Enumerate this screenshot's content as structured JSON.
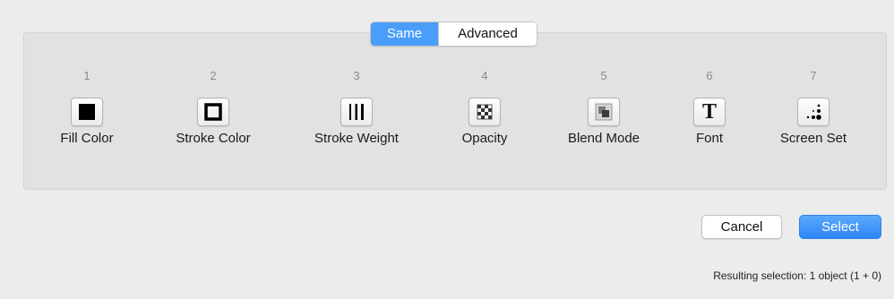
{
  "tabs": {
    "same_label": "Same",
    "advanced_label": "Advanced",
    "active": "Same"
  },
  "options": [
    {
      "number": "1",
      "label": "Fill Color",
      "icon": "fill-color-icon"
    },
    {
      "number": "2",
      "label": "Stroke Color",
      "icon": "stroke-color-icon"
    },
    {
      "number": "3",
      "label": "Stroke Weight",
      "icon": "stroke-weight-icon"
    },
    {
      "number": "4",
      "label": "Opacity",
      "icon": "opacity-icon"
    },
    {
      "number": "5",
      "label": "Blend Mode",
      "icon": "blend-mode-icon"
    },
    {
      "number": "6",
      "label": "Font",
      "icon": "font-icon",
      "glyph": "T"
    },
    {
      "number": "7",
      "label": "Screen Set",
      "icon": "screen-set-icon"
    }
  ],
  "buttons": {
    "cancel_label": "Cancel",
    "select_label": "Select"
  },
  "status": {
    "text": "Resulting selection: 1 object (1 + 0)"
  },
  "colors": {
    "accent": "#4a9df8",
    "background": "#ececec",
    "panel": "#e2e2e2"
  }
}
